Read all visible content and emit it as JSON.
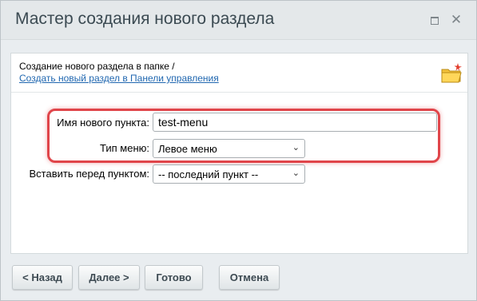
{
  "window": {
    "title": "Мастер создания нового раздела"
  },
  "header": {
    "text": "Создание нового раздела в папке /",
    "link": "Создать новый раздел в Панели управления"
  },
  "form": {
    "name_label": "Имя нового пункта:",
    "name_value": "test-menu",
    "menu_type_label": "Тип меню:",
    "menu_type_value": "Левое меню",
    "insert_before_label": "Вставить перед пунктом:",
    "insert_before_value": "-- последний пункт --"
  },
  "buttons": {
    "back": "< Назад",
    "next": "Далее >",
    "done": "Готово",
    "cancel": "Отмена"
  },
  "icons": {
    "maximize": "maximize-icon",
    "close": "close-icon",
    "folder": "new-folder-icon"
  },
  "colors": {
    "highlight": "#e0454a",
    "link": "#2067b0"
  }
}
